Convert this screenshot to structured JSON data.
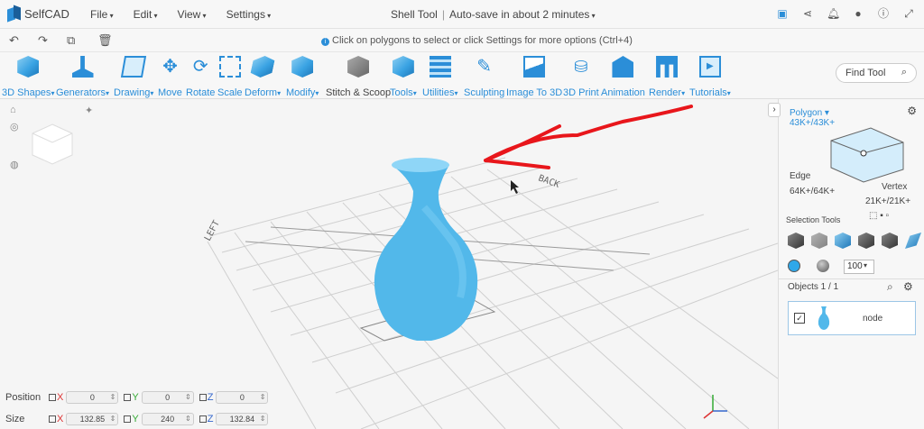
{
  "app": {
    "name": "SelfCAD"
  },
  "menu": [
    "File",
    "Edit",
    "View",
    "Settings"
  ],
  "document": {
    "title": "Shell Tool",
    "autosave": "Auto-save in about 2 minutes"
  },
  "hint": "Click on polygons to select or click Settings for more options (Ctrl+4)",
  "toolbar": [
    {
      "label": "3D Shapes",
      "dropdown": true
    },
    {
      "label": "Generators",
      "dropdown": true
    },
    {
      "label": "Drawing",
      "dropdown": true
    },
    {
      "label": "Move",
      "dropdown": false
    },
    {
      "label": "Rotate",
      "dropdown": false
    },
    {
      "label": "Scale",
      "dropdown": false
    },
    {
      "label": "Deform",
      "dropdown": true
    },
    {
      "label": "Modify",
      "dropdown": true
    },
    {
      "label": "Stitch & Scoop",
      "dropdown": false
    },
    {
      "label": "Tools",
      "dropdown": true
    },
    {
      "label": "Utilities",
      "dropdown": true
    },
    {
      "label": "Sculpting",
      "dropdown": false
    },
    {
      "label": "Image To 3D",
      "dropdown": false
    },
    {
      "label": "3D Print",
      "dropdown": false
    },
    {
      "label": "Animation",
      "dropdown": false
    },
    {
      "label": "Render",
      "dropdown": true
    },
    {
      "label": "Tutorials",
      "dropdown": true
    }
  ],
  "find_tool": "Find Tool",
  "viewport": {
    "labels": {
      "back": "BACK",
      "left": "LEFT"
    },
    "vase_color": "#52b8ea",
    "annotation_color": "#e8161b"
  },
  "transform": {
    "position": {
      "label": "Position",
      "x": "0",
      "y": "0",
      "z": "0"
    },
    "size": {
      "label": "Size",
      "x": "132.85",
      "y": "240",
      "z": "132.84"
    }
  },
  "right_panel": {
    "mode": "Polygon",
    "polygon_count": "43K+/43K+",
    "edge_label": "Edge",
    "edge_count": "64K+/64K+",
    "vertex_label": "Vertex",
    "vertex_count": "21K+/21K+",
    "selection_tools": "Selection Tools",
    "brush_size": "100",
    "objects_title": "Objects 1 / 1",
    "object_name": "node"
  }
}
